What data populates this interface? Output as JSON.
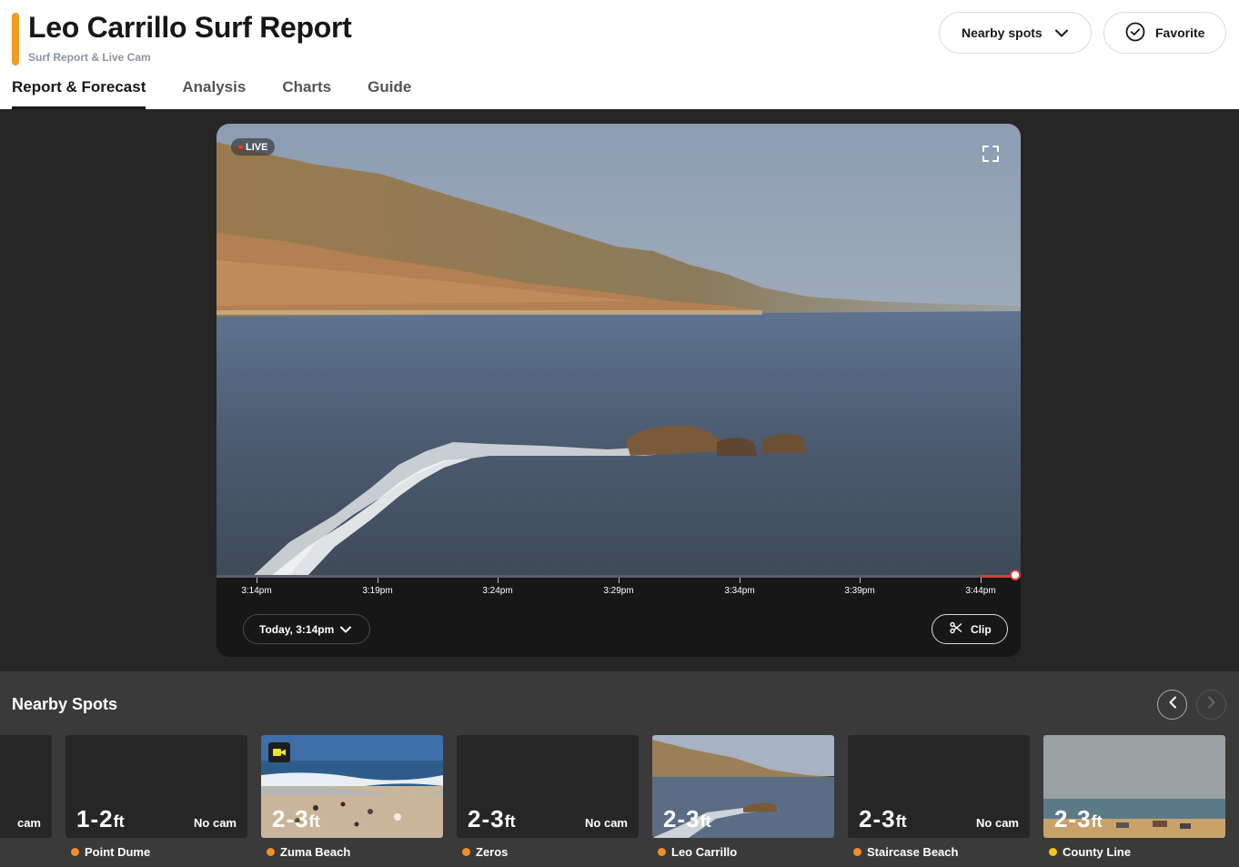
{
  "header": {
    "title": "Leo Carrillo Surf Report",
    "subtitle": "Surf Report & Live Cam",
    "nearby_label": "Nearby spots",
    "favorite_label": "Favorite",
    "accent_color": "#f59a23"
  },
  "tabs": [
    {
      "label": "Report & Forecast",
      "active": true
    },
    {
      "label": "Analysis",
      "active": false
    },
    {
      "label": "Charts",
      "active": false
    },
    {
      "label": "Guide",
      "active": false
    }
  ],
  "player": {
    "live_label": "LIVE",
    "timeline_ticks": [
      "3:14pm",
      "3:19pm",
      "3:24pm",
      "3:29pm",
      "3:34pm",
      "3:39pm",
      "3:44pm"
    ],
    "date_label": "Today, 3:14pm",
    "clip_label": "Clip",
    "icons": [
      "fullscreen-icon",
      "chevron-down-icon",
      "scissors-icon"
    ]
  },
  "nearby": {
    "title": "Nearby Spots",
    "spots": [
      {
        "height": "",
        "unit": "",
        "cam": "cam",
        "name": "",
        "condition_color": ""
      },
      {
        "height": "1-2",
        "unit": "ft",
        "cam": "No cam",
        "name": "Point Dume",
        "condition_color": "#f28c28"
      },
      {
        "height": "2-3",
        "unit": "ft",
        "cam": "",
        "name": "Zuma Beach",
        "condition_color": "#f28c28"
      },
      {
        "height": "2-3",
        "unit": "ft",
        "cam": "No cam",
        "name": "Zeros",
        "condition_color": "#f28c28"
      },
      {
        "height": "2-3",
        "unit": "ft",
        "cam": "",
        "name": "Leo Carrillo",
        "condition_color": "#f28c28"
      },
      {
        "height": "2-3",
        "unit": "ft",
        "cam": "No cam",
        "name": "Staircase Beach",
        "condition_color": "#f28c28"
      },
      {
        "height": "2-3",
        "unit": "ft",
        "cam": "",
        "name": "County Line",
        "condition_color": "#f5c518"
      }
    ]
  }
}
